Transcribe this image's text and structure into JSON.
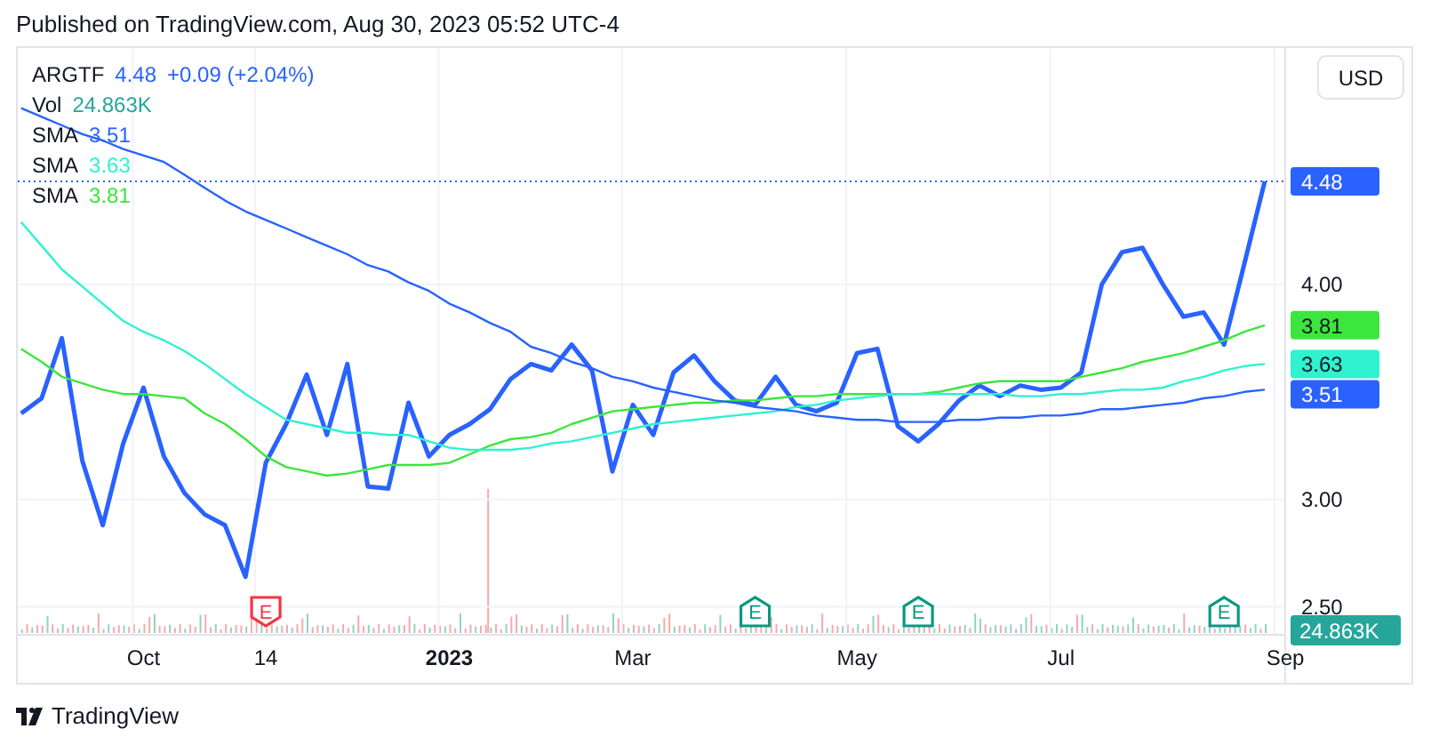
{
  "header": {
    "published": "Published on TradingView.com, Aug 30, 2023 05:52 UTC-4"
  },
  "legend": [
    {
      "value": "4.48",
      "change": "+0.09 (+2.04%)",
      "color": "#2962ff"
    },
    {
      "label": "Vol",
      "value": "24.863K",
      "color": "#26a69a"
    },
    {
      "value": "3.51",
      "color": "#2962ff"
    },
    {
      "value": "3.63",
      "color": "#2ef2d0"
    },
    {
      "value": "3.81",
      "color": "#3ce63c"
    }
  ],
  "currency_button": "USD",
  "chart": {
    "chart_data": {
      "type": "line",
      "categories": [
        null,
        null,
        null,
        null,
        null,
        null,
        "Oct",
        null,
        null,
        null,
        null,
        null,
        "14",
        null,
        null,
        null,
        null,
        null,
        null,
        null,
        null,
        "2023",
        null,
        null,
        null,
        null,
        null,
        null,
        null,
        null,
        "Mar",
        null,
        null,
        null,
        null,
        null,
        null,
        null,
        null,
        null,
        null,
        "May",
        null,
        null,
        null,
        null,
        null,
        null,
        null,
        null,
        null,
        "Jul",
        null,
        null,
        null,
        null,
        null,
        null,
        null,
        null,
        null,
        null,
        "Sep"
      ],
      "series": [
        {
          "name": "ARGTF",
          "color": "#2962ff",
          "values": [
            3.4,
            3.47,
            3.75,
            3.18,
            2.88,
            3.26,
            3.52,
            3.2,
            3.03,
            2.93,
            2.88,
            2.64,
            3.17,
            3.35,
            3.58,
            3.3,
            3.63,
            3.06,
            3.05,
            3.45,
            3.2,
            3.3,
            3.35,
            3.42,
            3.56,
            3.63,
            3.6,
            3.72,
            3.6,
            3.13,
            3.44,
            3.3,
            3.59,
            3.67,
            3.55,
            3.46,
            3.44,
            3.57,
            3.44,
            3.41,
            3.45,
            3.68,
            3.7,
            3.34,
            3.27,
            3.35,
            3.46,
            3.53,
            3.48,
            3.53,
            3.51,
            3.52,
            3.59,
            4.0,
            4.15,
            4.17,
            4.0,
            3.85,
            3.87,
            3.72,
            4.1,
            4.48,
            null
          ]
        },
        {
          "name": "SMA",
          "color": "#3ce63c",
          "values": [
            3.7,
            3.64,
            3.57,
            3.54,
            3.51,
            3.49,
            3.49,
            3.48,
            3.47,
            3.4,
            3.35,
            3.28,
            3.2,
            3.15,
            3.13,
            3.11,
            3.12,
            3.14,
            3.16,
            3.16,
            3.16,
            3.17,
            3.21,
            3.25,
            3.28,
            3.29,
            3.31,
            3.35,
            3.38,
            3.41,
            3.42,
            3.43,
            3.44,
            3.45,
            3.45,
            3.46,
            3.46,
            3.47,
            3.48,
            3.48,
            3.49,
            3.49,
            3.49,
            3.49,
            3.49,
            3.5,
            3.52,
            3.54,
            3.55,
            3.55,
            3.55,
            3.55,
            3.57,
            3.59,
            3.61,
            3.64,
            3.66,
            3.68,
            3.71,
            3.74,
            3.78,
            3.81,
            null
          ]
        },
        {
          "name": "SMA",
          "color": "#2ef2d0",
          "values": [
            4.29,
            4.18,
            4.07,
            3.99,
            3.91,
            3.83,
            3.78,
            3.74,
            3.69,
            3.63,
            3.56,
            3.49,
            3.43,
            3.37,
            3.35,
            3.33,
            3.31,
            3.31,
            3.3,
            3.3,
            3.27,
            3.24,
            3.23,
            3.23,
            3.23,
            3.24,
            3.26,
            3.27,
            3.29,
            3.31,
            3.33,
            3.35,
            3.36,
            3.37,
            3.38,
            3.39,
            3.4,
            3.41,
            3.43,
            3.44,
            3.46,
            3.47,
            3.48,
            3.49,
            3.49,
            3.49,
            3.49,
            3.49,
            3.49,
            3.48,
            3.48,
            3.49,
            3.49,
            3.5,
            3.51,
            3.51,
            3.52,
            3.55,
            3.57,
            3.6,
            3.62,
            3.63,
            null
          ]
        },
        {
          "name": "SMA",
          "color": "#2962ff",
          "values": [
            4.82,
            4.78,
            4.74,
            4.7,
            4.67,
            4.63,
            4.6,
            4.57,
            4.51,
            4.45,
            4.39,
            4.34,
            4.3,
            4.26,
            4.22,
            4.18,
            4.14,
            4.09,
            4.06,
            4.01,
            3.97,
            3.91,
            3.87,
            3.82,
            3.78,
            3.71,
            3.68,
            3.64,
            3.61,
            3.57,
            3.55,
            3.52,
            3.5,
            3.48,
            3.46,
            3.45,
            3.43,
            3.42,
            3.41,
            3.39,
            3.38,
            3.37,
            3.37,
            3.36,
            3.36,
            3.36,
            3.37,
            3.37,
            3.38,
            3.38,
            3.39,
            3.39,
            3.4,
            3.42,
            3.42,
            3.43,
            3.44,
            3.45,
            3.47,
            3.48,
            3.5,
            3.51,
            null
          ]
        }
      ],
      "ylim": [
        2.37,
        5.1
      ],
      "grid": true,
      "ref_lines": [
        {
          "axis": "y",
          "value": 4.48,
          "color": "#2962ff"
        }
      ],
      "yticks": [
        {
          "value": 2.5,
          "label": "2.50"
        },
        {
          "value": 3,
          "label": "3.00"
        },
        {
          "value": 4,
          "label": "4.00"
        }
      ]
    },
    "time_axis_bold": [
      false,
      false,
      true,
      false,
      false,
      false,
      false
    ],
    "price_badges": [
      {
        "label": "4.48",
        "color": "#2962ff"
      },
      {
        "label": "3.81",
        "color": "#3ce63c"
      },
      {
        "label": "3.63",
        "color": "#2ef2d0"
      },
      {
        "label": "3.51",
        "color": "#2962ff"
      }
    ],
    "volume_badge": {
      "label": "24.863K",
      "color": "#26a69a"
    },
    "events": [
      {
        "label": "E",
        "kind": "down",
        "color": "#f23645"
      },
      {
        "label": "E",
        "kind": "up",
        "color": "#089981"
      },
      {
        "label": "E",
        "kind": "up",
        "color": "#089981"
      },
      {
        "label": "E",
        "kind": "up",
        "color": "#089981"
      }
    ]
  },
  "footer": {
    "brand": "TradingView"
  }
}
